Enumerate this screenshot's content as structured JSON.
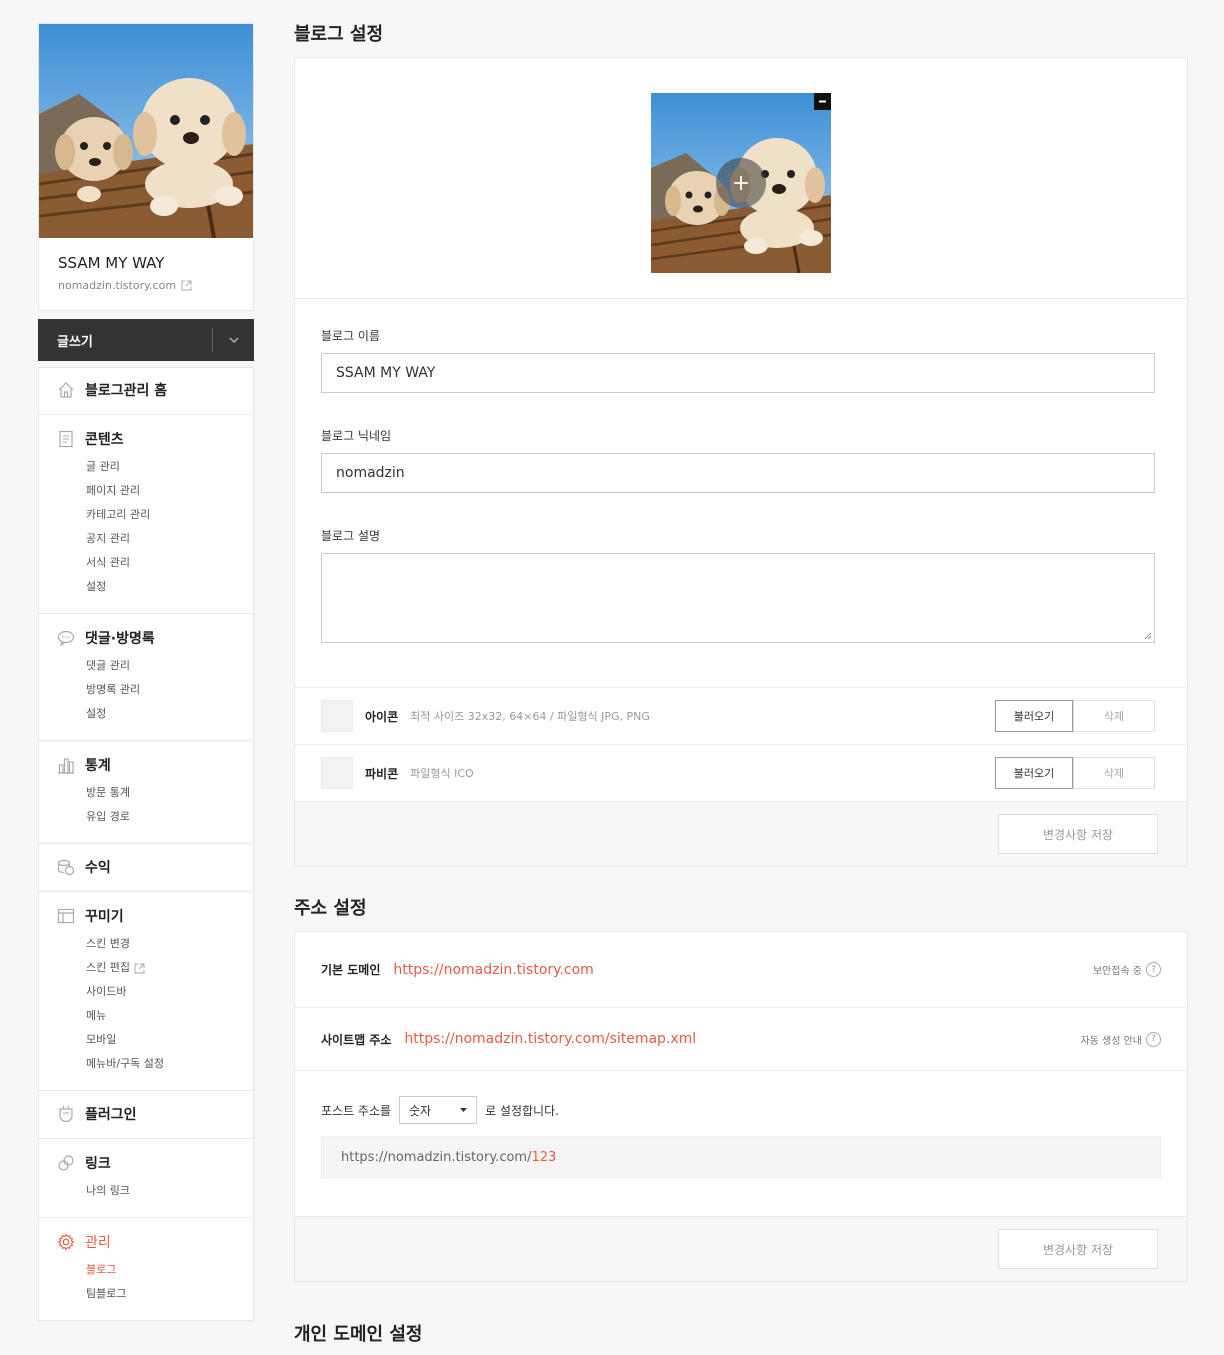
{
  "sidebar": {
    "blog_title": "SSAM MY WAY",
    "blog_url": "nomadzin.tistory.com",
    "write_label": "글쓰기",
    "menu": {
      "home": "블로그관리 홈",
      "content": {
        "label": "콘텐츠",
        "items": [
          "글 관리",
          "페이지 관리",
          "카테고리 관리",
          "공지 관리",
          "서식 관리",
          "설정"
        ]
      },
      "comments": {
        "label": "댓글·방명록",
        "items": [
          "댓글 관리",
          "방명록 관리",
          "설정"
        ]
      },
      "stats": {
        "label": "통계",
        "items": [
          "방문 통계",
          "유입 경로"
        ]
      },
      "revenue": {
        "label": "수익"
      },
      "design": {
        "label": "꾸미기",
        "items": [
          "스킨 변경",
          "스킨 편집",
          "사이드바",
          "메뉴",
          "모바일",
          "메뉴바/구독 설정"
        ]
      },
      "plugin": {
        "label": "플러그인"
      },
      "link": {
        "label": "링크",
        "items": [
          "나의 링크"
        ]
      },
      "manage": {
        "label": "관리",
        "items": [
          "블로그",
          "팀블로그"
        ]
      }
    }
  },
  "blog_settings": {
    "title": "블로그 설정",
    "name_label": "블로그 이름",
    "name_value": "SSAM MY WAY",
    "nickname_label": "블로그 닉네임",
    "nickname_value": "nomadzin",
    "desc_label": "블로그 설명",
    "desc_value": "",
    "icon": {
      "name": "아이콘",
      "desc": "최적 사이즈 32x32, 64×64 / 파일형식 JPG, PNG",
      "load": "불러오기",
      "delete": "삭제"
    },
    "favicon": {
      "name": "파비콘",
      "desc": "파일형식 ICO",
      "load": "불러오기",
      "delete": "삭제"
    },
    "save": "변경사항 저장"
  },
  "address_settings": {
    "title": "주소 설정",
    "default_domain_label": "기본 도메인",
    "default_domain_url": "https://nomadzin.tistory.com",
    "default_domain_help": "보안접속 중",
    "sitemap_label": "사이트맵 주소",
    "sitemap_url": "https://nomadzin.tistory.com/sitemap.xml",
    "sitemap_help": "자동 생성 안내",
    "post_prefix": "포스트 주소를",
    "post_select": "숫자",
    "post_suffix": "로 설정합니다.",
    "preview_base": "https://nomadzin.tistory.com/",
    "preview_num": "123",
    "save": "변경사항 저장",
    "help_mark": "?"
  },
  "personal_domain": {
    "title": "개인 도메인 설정"
  },
  "colors": {
    "accent": "#e65c42",
    "dark_bar": "#333333"
  }
}
